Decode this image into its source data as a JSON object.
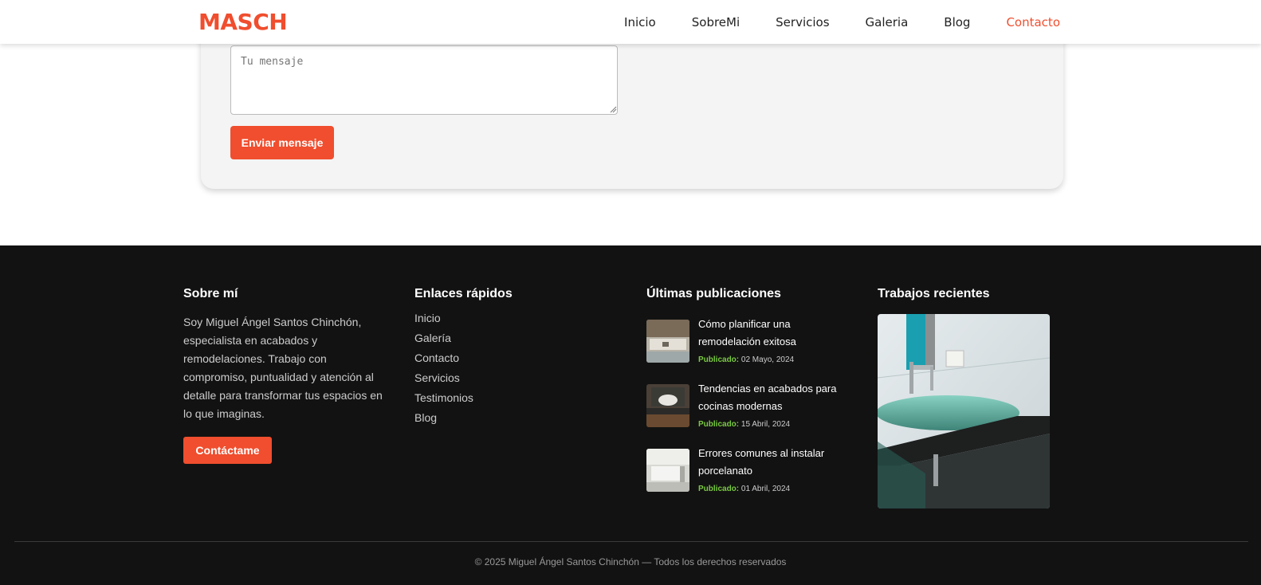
{
  "header": {
    "logo": "MASCH",
    "nav": [
      "Inicio",
      "SobreMi",
      "Servicios",
      "Galeria",
      "Blog",
      "Contacto"
    ],
    "active": "Contacto",
    "accent": "#f04e2e"
  },
  "form": {
    "message_placeholder": "Tu mensaje",
    "send_label": "Enviar mensaje"
  },
  "footer": {
    "about": {
      "title": "Sobre mí",
      "text": "Soy Miguel Ángel Santos Chinchón, especialista en acabados y remodelaciones. Trabajo con compromiso, puntualidad y atención al detalle para transformar tus espacios en lo que imaginas.",
      "button": "Contáctame"
    },
    "links": {
      "title": "Enlaces rápidos",
      "items": [
        "Inicio",
        "Galería",
        "Contacto",
        "Servicios",
        "Testimonios",
        "Blog"
      ]
    },
    "posts": {
      "title": "Últimas publicaciones",
      "items": [
        {
          "title": "Cómo planificar una remodelación exitosa",
          "label": "Publicado:",
          "date": "02 Mayo, 2024"
        },
        {
          "title": "Tendencias en acabados para cocinas modernas",
          "label": "Publicado:",
          "date": "15 Abril, 2024"
        },
        {
          "title": "Errores comunes al instalar porcelanato",
          "label": "Publicado:",
          "date": "01 Abril, 2024"
        }
      ]
    },
    "recent": {
      "title": "Trabajos recientes"
    },
    "copyright": "© 2025 Miguel Ángel Santos Chinchón — Todos los derechos reservados"
  }
}
